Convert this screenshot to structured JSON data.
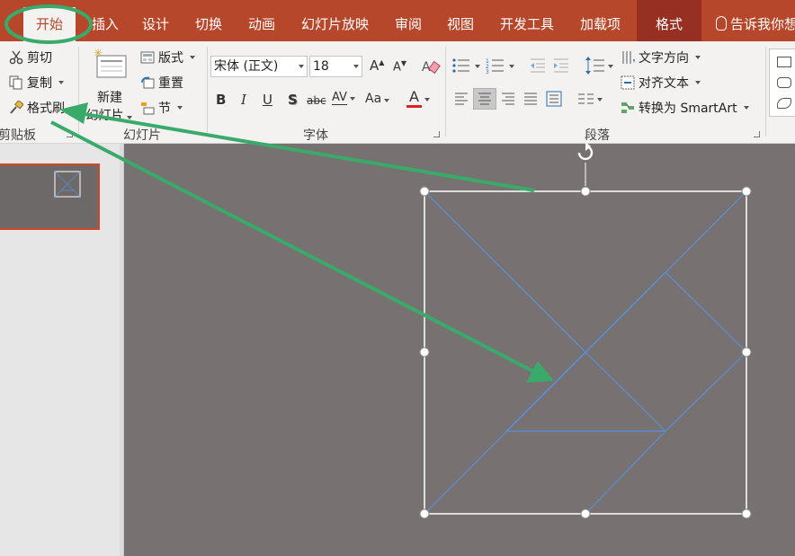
{
  "tabs": [
    {
      "label": "开始",
      "active": true
    },
    {
      "label": "插入"
    },
    {
      "label": "设计"
    },
    {
      "label": "切换"
    },
    {
      "label": "动画"
    },
    {
      "label": "幻灯片放映"
    },
    {
      "label": "审阅"
    },
    {
      "label": "视图"
    },
    {
      "label": "开发工具"
    },
    {
      "label": "加载项"
    },
    {
      "label": "格式",
      "contextual": true
    }
  ],
  "tellme": {
    "label": "告诉我你想"
  },
  "clipboard": {
    "cut": "剪切",
    "copy": "复制",
    "format_painter": "格式刷",
    "group_label": "剪贴板"
  },
  "slides": {
    "new_slide_line1": "新建",
    "new_slide_line2": "幻灯片",
    "layout": "版式",
    "reset": "重置",
    "section": "节",
    "group_label": "幻灯片"
  },
  "font": {
    "font_name": "宋体 (正文)",
    "font_size": "18",
    "grow": "A",
    "shrink": "A",
    "bold": "B",
    "italic": "I",
    "underline": "U",
    "shadow": "S",
    "strike": "abc",
    "spacing": "AV",
    "case": "Aa",
    "color": "A",
    "group_label": "字体"
  },
  "paragraph": {
    "text_direction": "文字方向",
    "align_text": "对齐文本",
    "smartart": "转换为 SmartArt",
    "group_label": "段落"
  },
  "colors": {
    "accent": "#b7472a",
    "contextual_tab": "#982f23",
    "annotation": "#3aaa6a",
    "slide_bg": "#777271",
    "shape_lines": "#5b8fd6"
  }
}
